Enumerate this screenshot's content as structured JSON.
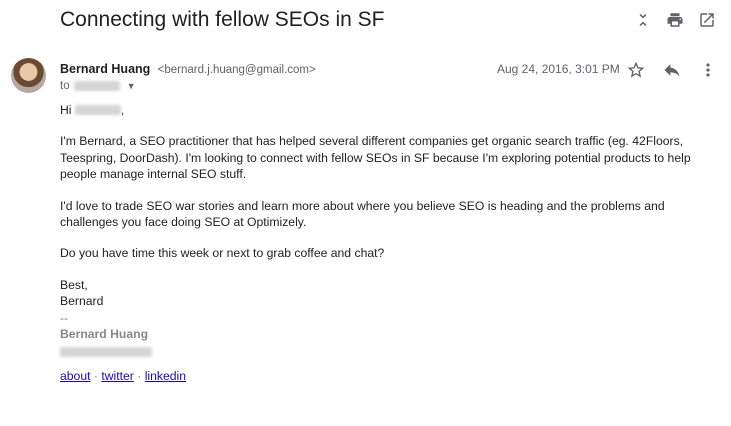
{
  "email": {
    "subject": "Connecting with fellow SEOs in SF",
    "sender_name": "Bernard Huang",
    "sender_email": "<bernard.j.huang@gmail.com>",
    "to_label": "to",
    "date": "Aug 24, 2016, 3:01 PM",
    "greeting": "Hi",
    "paragraphs": [
      "I'm Bernard, a SEO practitioner that has helped several different companies get organic search traffic (eg. 42Floors, Teespring, DoorDash). I'm looking to connect with fellow SEOs in SF because I'm exploring potential products to help people manage internal SEO stuff.",
      "I'd love to trade SEO war stories and learn more about where you believe SEO is heading and the problems and challenges you face doing SEO at Optimizely.",
      "Do you have time this week or next to grab coffee and chat?"
    ],
    "closing": "Best,",
    "closing_name": "Bernard",
    "signature_dash": "--",
    "signature_name": "Bernard Huang",
    "links": [
      "about",
      "twitter",
      "linkedin"
    ],
    "link_separator": " · "
  },
  "icons": {
    "top": [
      "collapse-icon",
      "print-icon",
      "open-new-window-icon"
    ],
    "message": [
      "star-icon",
      "reply-icon",
      "more-vert-icon"
    ],
    "recipient_dropdown": "dropdown-arrow-icon"
  }
}
